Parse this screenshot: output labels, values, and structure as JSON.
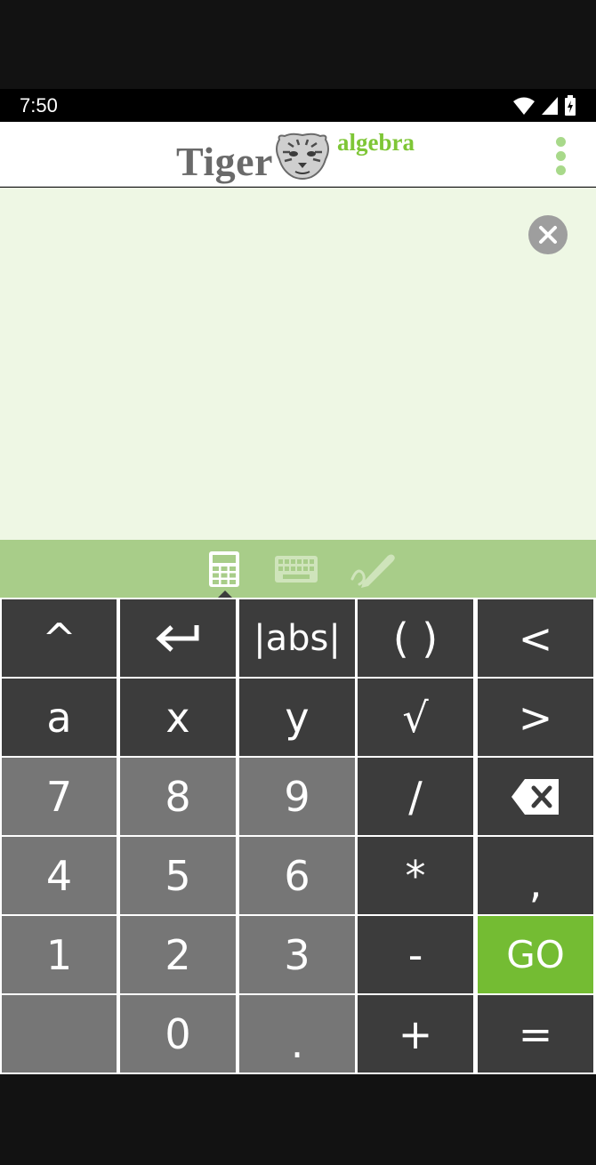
{
  "status_bar": {
    "time": "7:50"
  },
  "app": {
    "logo_word": "Tiger",
    "logo_suffix": "algebra"
  },
  "keypad": {
    "rows": [
      [
        {
          "label": "^",
          "style": "dark"
        },
        {
          "label": "",
          "icon": "enter-icon",
          "style": "dark"
        },
        {
          "label": "|abs|",
          "style": "dark"
        },
        {
          "label": "( )",
          "style": "dark"
        },
        {
          "label": "<",
          "style": "dark"
        }
      ],
      [
        {
          "label": "a",
          "style": "dark"
        },
        {
          "label": "x",
          "style": "dark"
        },
        {
          "label": "y",
          "style": "dark"
        },
        {
          "label": "√",
          "style": "dark"
        },
        {
          "label": ">",
          "style": "dark"
        }
      ],
      [
        {
          "label": "7",
          "style": "gray"
        },
        {
          "label": "8",
          "style": "gray"
        },
        {
          "label": "9",
          "style": "gray"
        },
        {
          "label": "/",
          "style": "dark"
        },
        {
          "label": "",
          "icon": "backspace-icon",
          "style": "dark"
        }
      ],
      [
        {
          "label": "4",
          "style": "gray"
        },
        {
          "label": "5",
          "style": "gray"
        },
        {
          "label": "6",
          "style": "gray"
        },
        {
          "label": "*",
          "style": "dark"
        },
        {
          "label": ",",
          "style": "dark"
        }
      ],
      [
        {
          "label": "1",
          "style": "gray"
        },
        {
          "label": "2",
          "style": "gray"
        },
        {
          "label": "3",
          "style": "gray"
        },
        {
          "label": "-",
          "style": "dark"
        },
        {
          "label": "GO",
          "style": "green"
        }
      ],
      [
        {
          "label": "",
          "style": "gray"
        },
        {
          "label": "0",
          "style": "gray"
        },
        {
          "label": ".",
          "style": "gray"
        },
        {
          "label": "+",
          "style": "dark"
        },
        {
          "label": "=",
          "style": "dark"
        }
      ]
    ]
  },
  "input_modes": [
    {
      "name": "calculator-mode",
      "icon": "calculator-icon",
      "active": true
    },
    {
      "name": "keyboard-mode",
      "icon": "keyboard-icon",
      "active": false
    },
    {
      "name": "handwriting-mode",
      "icon": "pen-icon",
      "active": false
    }
  ],
  "colors": {
    "accent_green": "#74bc33",
    "light_green_bg": "#eef7e4",
    "mode_bar": "#a8cd89",
    "key_dark": "#3c3c3c",
    "key_gray": "#767676"
  }
}
